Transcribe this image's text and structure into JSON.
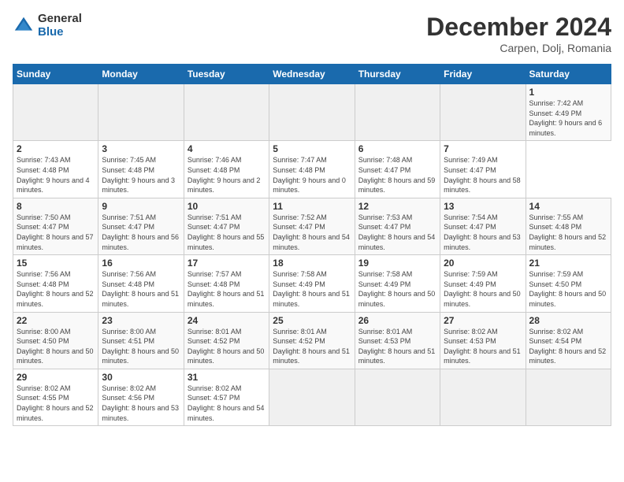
{
  "header": {
    "logo_general": "General",
    "logo_blue": "Blue",
    "month_title": "December 2024",
    "location": "Carpen, Dolj, Romania"
  },
  "calendar": {
    "days_of_week": [
      "Sunday",
      "Monday",
      "Tuesday",
      "Wednesday",
      "Thursday",
      "Friday",
      "Saturday"
    ],
    "weeks": [
      [
        null,
        null,
        null,
        null,
        null,
        null,
        {
          "day": "1",
          "sunrise": "7:42 AM",
          "sunset": "4:49 PM",
          "daylight": "9 hours and 6 minutes."
        }
      ],
      [
        {
          "day": "2",
          "sunrise": "7:43 AM",
          "sunset": "4:48 PM",
          "daylight": "9 hours and 4 minutes."
        },
        {
          "day": "3",
          "sunrise": "7:45 AM",
          "sunset": "4:48 PM",
          "daylight": "9 hours and 3 minutes."
        },
        {
          "day": "4",
          "sunrise": "7:46 AM",
          "sunset": "4:48 PM",
          "daylight": "9 hours and 2 minutes."
        },
        {
          "day": "5",
          "sunrise": "7:47 AM",
          "sunset": "4:48 PM",
          "daylight": "9 hours and 0 minutes."
        },
        {
          "day": "6",
          "sunrise": "7:48 AM",
          "sunset": "4:47 PM",
          "daylight": "8 hours and 59 minutes."
        },
        {
          "day": "7",
          "sunrise": "7:49 AM",
          "sunset": "4:47 PM",
          "daylight": "8 hours and 58 minutes."
        }
      ],
      [
        {
          "day": "8",
          "sunrise": "7:50 AM",
          "sunset": "4:47 PM",
          "daylight": "8 hours and 57 minutes."
        },
        {
          "day": "9",
          "sunrise": "7:51 AM",
          "sunset": "4:47 PM",
          "daylight": "8 hours and 56 minutes."
        },
        {
          "day": "10",
          "sunrise": "7:51 AM",
          "sunset": "4:47 PM",
          "daylight": "8 hours and 55 minutes."
        },
        {
          "day": "11",
          "sunrise": "7:52 AM",
          "sunset": "4:47 PM",
          "daylight": "8 hours and 54 minutes."
        },
        {
          "day": "12",
          "sunrise": "7:53 AM",
          "sunset": "4:47 PM",
          "daylight": "8 hours and 54 minutes."
        },
        {
          "day": "13",
          "sunrise": "7:54 AM",
          "sunset": "4:47 PM",
          "daylight": "8 hours and 53 minutes."
        },
        {
          "day": "14",
          "sunrise": "7:55 AM",
          "sunset": "4:48 PM",
          "daylight": "8 hours and 52 minutes."
        }
      ],
      [
        {
          "day": "15",
          "sunrise": "7:56 AM",
          "sunset": "4:48 PM",
          "daylight": "8 hours and 52 minutes."
        },
        {
          "day": "16",
          "sunrise": "7:56 AM",
          "sunset": "4:48 PM",
          "daylight": "8 hours and 51 minutes."
        },
        {
          "day": "17",
          "sunrise": "7:57 AM",
          "sunset": "4:48 PM",
          "daylight": "8 hours and 51 minutes."
        },
        {
          "day": "18",
          "sunrise": "7:58 AM",
          "sunset": "4:49 PM",
          "daylight": "8 hours and 51 minutes."
        },
        {
          "day": "19",
          "sunrise": "7:58 AM",
          "sunset": "4:49 PM",
          "daylight": "8 hours and 50 minutes."
        },
        {
          "day": "20",
          "sunrise": "7:59 AM",
          "sunset": "4:49 PM",
          "daylight": "8 hours and 50 minutes."
        },
        {
          "day": "21",
          "sunrise": "7:59 AM",
          "sunset": "4:50 PM",
          "daylight": "8 hours and 50 minutes."
        }
      ],
      [
        {
          "day": "22",
          "sunrise": "8:00 AM",
          "sunset": "4:50 PM",
          "daylight": "8 hours and 50 minutes."
        },
        {
          "day": "23",
          "sunrise": "8:00 AM",
          "sunset": "4:51 PM",
          "daylight": "8 hours and 50 minutes."
        },
        {
          "day": "24",
          "sunrise": "8:01 AM",
          "sunset": "4:52 PM",
          "daylight": "8 hours and 50 minutes."
        },
        {
          "day": "25",
          "sunrise": "8:01 AM",
          "sunset": "4:52 PM",
          "daylight": "8 hours and 51 minutes."
        },
        {
          "day": "26",
          "sunrise": "8:01 AM",
          "sunset": "4:53 PM",
          "daylight": "8 hours and 51 minutes."
        },
        {
          "day": "27",
          "sunrise": "8:02 AM",
          "sunset": "4:53 PM",
          "daylight": "8 hours and 51 minutes."
        },
        {
          "day": "28",
          "sunrise": "8:02 AM",
          "sunset": "4:54 PM",
          "daylight": "8 hours and 52 minutes."
        }
      ],
      [
        {
          "day": "29",
          "sunrise": "8:02 AM",
          "sunset": "4:55 PM",
          "daylight": "8 hours and 52 minutes."
        },
        {
          "day": "30",
          "sunrise": "8:02 AM",
          "sunset": "4:56 PM",
          "daylight": "8 hours and 53 minutes."
        },
        {
          "day": "31",
          "sunrise": "8:02 AM",
          "sunset": "4:57 PM",
          "daylight": "8 hours and 54 minutes."
        },
        null,
        null,
        null,
        null
      ]
    ]
  }
}
